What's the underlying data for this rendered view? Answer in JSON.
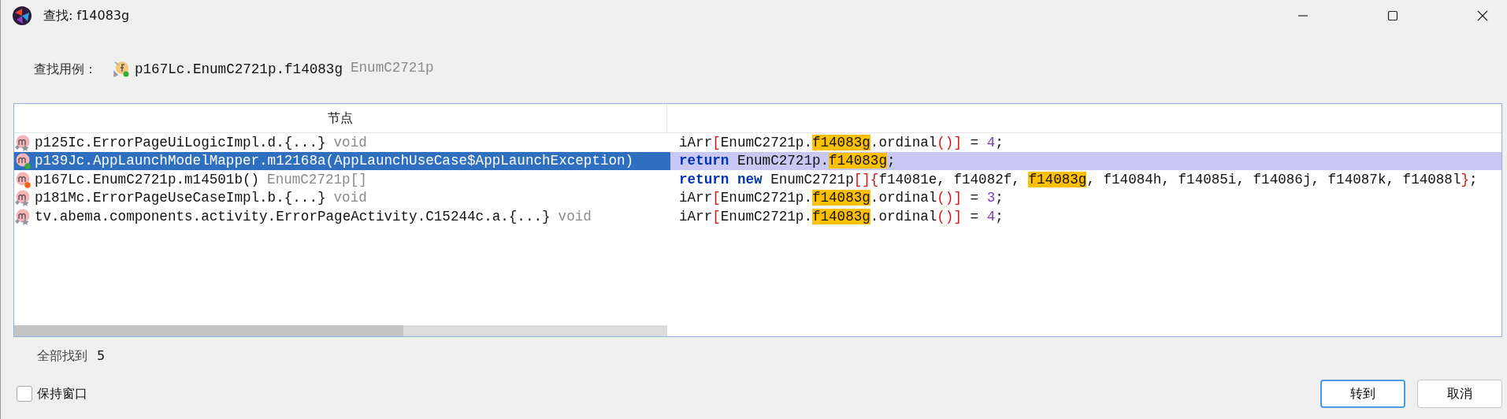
{
  "window": {
    "title": "查找: f14083g"
  },
  "query": {
    "label": "查找用例：",
    "name": "p167Lc.EnumC2721p.f14083g",
    "type": "EnumC2721p"
  },
  "table": {
    "columns": [
      "节点"
    ],
    "rows": [
      {
        "node": "p125Ic.ErrorPageUiLogicImpl.d.{...}",
        "type": "void",
        "kind": "marks",
        "selected": false,
        "code": [
          {
            "kind": "plain",
            "t": "iArr"
          },
          {
            "kind": "br",
            "t": "["
          },
          {
            "kind": "plain",
            "t": "EnumC2721p."
          },
          {
            "kind": "match",
            "t": "f14083g"
          },
          {
            "kind": "plain",
            "t": ".ordinal"
          },
          {
            "kind": "br",
            "t": "()]"
          },
          {
            "kind": "plain",
            "t": " = "
          },
          {
            "kind": "num",
            "t": "4"
          },
          {
            "kind": "plain",
            "t": ";"
          }
        ]
      },
      {
        "node": "p139Jc.AppLaunchModelMapper.m12168a(AppLaunchUseCase$AppLaunchException)",
        "kind": "dot",
        "color": "#3aa83a",
        "selected": true,
        "code": [
          {
            "kind": "kw",
            "t": "return"
          },
          {
            "kind": "plain",
            "t": " EnumC2721p."
          },
          {
            "kind": "match",
            "t": "f14083g"
          },
          {
            "kind": "plain",
            "t": ";"
          }
        ]
      },
      {
        "node": "p167Lc.EnumC2721p.m14501b()",
        "type": "EnumC2721p[]",
        "kind": "dot",
        "color": "#f0641e",
        "selected": false,
        "code": [
          {
            "kind": "kw",
            "t": "return new"
          },
          {
            "kind": "plain",
            "t": " EnumC2721p"
          },
          {
            "kind": "br",
            "t": "[]{"
          },
          {
            "kind": "plain",
            "t": "f14081e, f14082f, "
          },
          {
            "kind": "match",
            "t": "f14083g"
          },
          {
            "kind": "plain",
            "t": ", f14084h, f14085i, f14086j, f14087k, f14088l"
          },
          {
            "kind": "br",
            "t": "}"
          },
          {
            "kind": "plain",
            "t": ";"
          }
        ]
      },
      {
        "node": "p181Mc.ErrorPageUseCaseImpl.b.{...}",
        "type": "void",
        "kind": "marks",
        "selected": false,
        "code": [
          {
            "kind": "plain",
            "t": "iArr"
          },
          {
            "kind": "br",
            "t": "["
          },
          {
            "kind": "plain",
            "t": "EnumC2721p."
          },
          {
            "kind": "match",
            "t": "f14083g"
          },
          {
            "kind": "plain",
            "t": ".ordinal"
          },
          {
            "kind": "br",
            "t": "()]"
          },
          {
            "kind": "plain",
            "t": " = "
          },
          {
            "kind": "num",
            "t": "3"
          },
          {
            "kind": "plain",
            "t": ";"
          }
        ]
      },
      {
        "node": "tv.abema.components.activity.ErrorPageActivity.C15244c.a.{...}",
        "type": "void",
        "kind": "marks",
        "selected": false,
        "code": [
          {
            "kind": "plain",
            "t": "iArr"
          },
          {
            "kind": "br",
            "t": "["
          },
          {
            "kind": "plain",
            "t": "EnumC2721p."
          },
          {
            "kind": "match",
            "t": "f14083g"
          },
          {
            "kind": "plain",
            "t": ".ordinal"
          },
          {
            "kind": "br",
            "t": "()]"
          },
          {
            "kind": "plain",
            "t": " = "
          },
          {
            "kind": "num",
            "t": "4"
          },
          {
            "kind": "plain",
            "t": ";"
          }
        ]
      }
    ]
  },
  "found": {
    "label": "全部找到",
    "count": "5"
  },
  "keep_window": {
    "label": "保持窗口",
    "checked": false
  },
  "buttons": [
    {
      "label": "转到",
      "default": true
    },
    {
      "label": "取消",
      "default": false
    }
  ]
}
